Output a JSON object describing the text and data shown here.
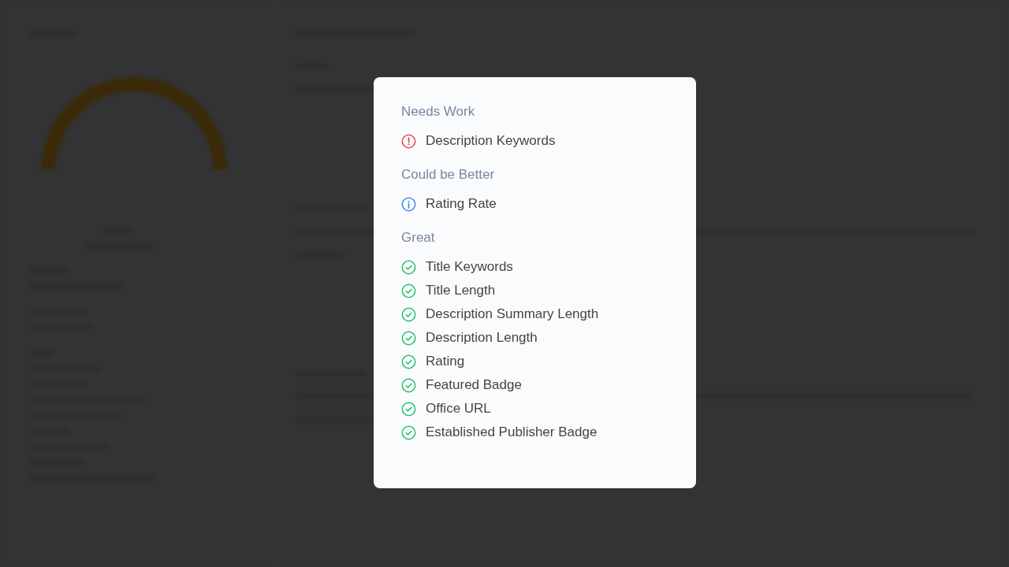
{
  "modal": {
    "groups": [
      {
        "title": "Needs Work",
        "kind": "warning",
        "items": [
          "Description Keywords"
        ]
      },
      {
        "title": "Could be Better",
        "kind": "info",
        "items": [
          "Rating Rate"
        ]
      },
      {
        "title": "Great",
        "kind": "ok",
        "items": [
          "Title Keywords",
          "Title Length",
          "Description Summary Length",
          "Description Length",
          "Rating",
          "Featured Badge",
          "Office URL",
          "Established Publisher Badge"
        ]
      }
    ]
  }
}
